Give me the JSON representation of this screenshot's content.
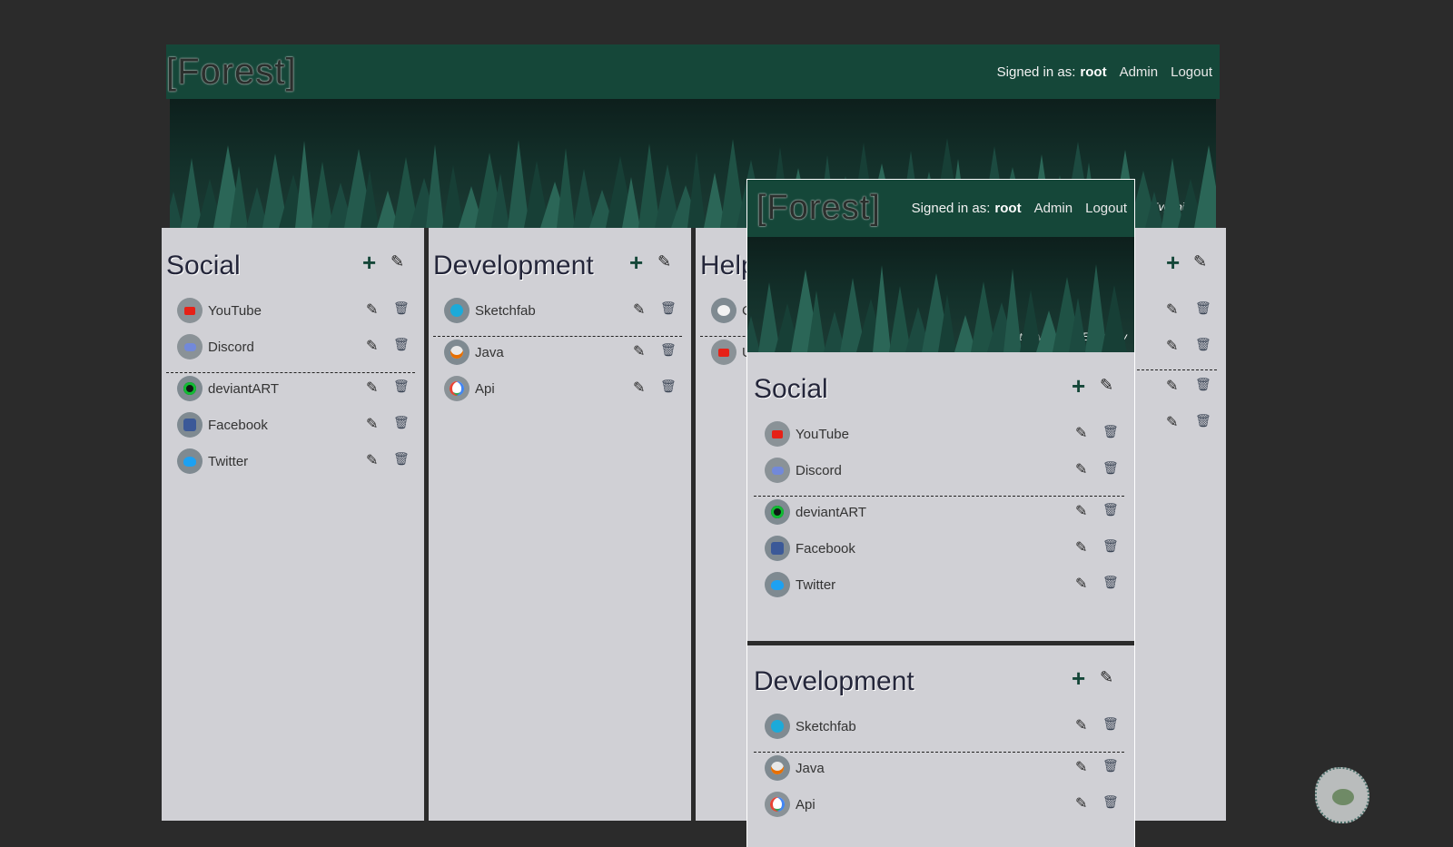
{
  "brand": "[Forest]",
  "user": {
    "signed_in_label": "Signed in as:",
    "username": "root",
    "admin_link": "Admin",
    "logout_link": "Logout"
  },
  "photo_credit": {
    "prefix": "Photo by",
    "author": "Evgeni Evgeniev"
  },
  "colors": {
    "header": "#154739",
    "panel": "#d0d0d5",
    "background": "#2b2b2b",
    "accent": "#154739"
  },
  "columns": [
    {
      "title": "Social",
      "groups": [
        [
          {
            "name": "YouTube",
            "icon": "youtube-icon"
          },
          {
            "name": "Discord",
            "icon": "discord-icon"
          }
        ],
        [
          {
            "name": "deviantART",
            "icon": "deviantart-icon"
          },
          {
            "name": "Facebook",
            "icon": "facebook-icon"
          },
          {
            "name": "Twitter",
            "icon": "twitter-icon"
          }
        ]
      ]
    },
    {
      "title": "Development",
      "groups": [
        [
          {
            "name": "Sketchfab",
            "icon": "sketchfab-icon"
          }
        ],
        [
          {
            "name": "Java",
            "icon": "java-icon"
          },
          {
            "name": "Api",
            "icon": "google-icon"
          }
        ]
      ]
    },
    {
      "title": "Help",
      "groups": [
        [
          {
            "name": "C",
            "icon": "palette-icon"
          }
        ],
        [
          {
            "name": "U",
            "icon": "youtube-icon"
          }
        ]
      ]
    }
  ],
  "overlay": {
    "brand": "[Forest]",
    "columns": [
      {
        "title": "Social"
      },
      {
        "title": "Development"
      }
    ]
  },
  "icons": {
    "add": "+",
    "edit": "✎",
    "delete": "🗑"
  }
}
